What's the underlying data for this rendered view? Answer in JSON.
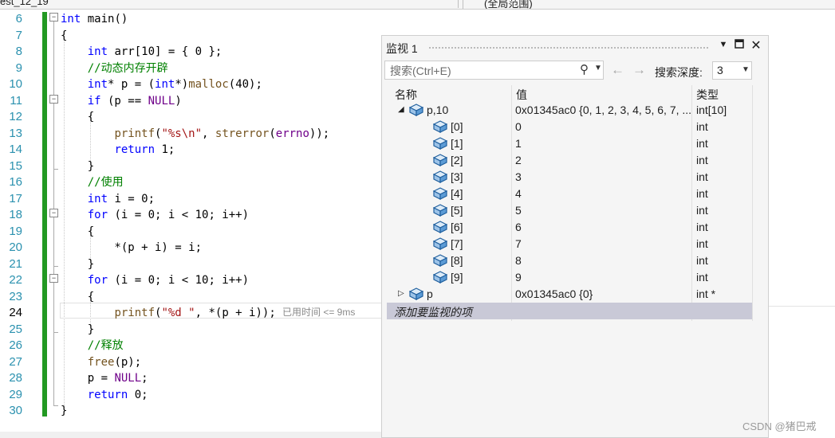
{
  "topbar": {
    "file_tab": "est_12_19",
    "scope": "(全局范围)"
  },
  "editor": {
    "current_line": 24,
    "lines": [
      {
        "n": "6",
        "segs": [
          {
            "t": "kw",
            "v": "int"
          },
          {
            "t": "",
            "v": " main()"
          }
        ]
      },
      {
        "n": "7",
        "segs": [
          {
            "t": "",
            "v": "{"
          }
        ]
      },
      {
        "n": "8",
        "segs": [
          {
            "t": "",
            "v": "    "
          },
          {
            "t": "kw",
            "v": "int"
          },
          {
            "t": "",
            "v": " arr[10] = { 0 };"
          }
        ]
      },
      {
        "n": "9",
        "segs": [
          {
            "t": "",
            "v": "    "
          },
          {
            "t": "cm",
            "v": "//动态内存开辟"
          }
        ]
      },
      {
        "n": "10",
        "segs": [
          {
            "t": "",
            "v": "    "
          },
          {
            "t": "kw",
            "v": "int"
          },
          {
            "t": "",
            "v": "* p = ("
          },
          {
            "t": "kw",
            "v": "int"
          },
          {
            "t": "",
            "v": "*)"
          },
          {
            "t": "fn",
            "v": "malloc"
          },
          {
            "t": "",
            "v": "(40);"
          }
        ]
      },
      {
        "n": "11",
        "segs": [
          {
            "t": "",
            "v": "    "
          },
          {
            "t": "kw",
            "v": "if"
          },
          {
            "t": "",
            "v": " (p == "
          },
          {
            "t": "mac",
            "v": "NULL"
          },
          {
            "t": "",
            "v": ")"
          }
        ]
      },
      {
        "n": "12",
        "segs": [
          {
            "t": "",
            "v": "    {"
          }
        ]
      },
      {
        "n": "13",
        "segs": [
          {
            "t": "",
            "v": "        "
          },
          {
            "t": "fn",
            "v": "printf"
          },
          {
            "t": "",
            "v": "("
          },
          {
            "t": "str",
            "v": "\"%s\\n\""
          },
          {
            "t": "",
            "v": ", "
          },
          {
            "t": "fn",
            "v": "strerror"
          },
          {
            "t": "",
            "v": "("
          },
          {
            "t": "mac",
            "v": "errno"
          },
          {
            "t": "",
            "v": "));"
          }
        ]
      },
      {
        "n": "14",
        "segs": [
          {
            "t": "",
            "v": "        "
          },
          {
            "t": "kw",
            "v": "return"
          },
          {
            "t": "",
            "v": " 1;"
          }
        ]
      },
      {
        "n": "15",
        "segs": [
          {
            "t": "",
            "v": "    }"
          }
        ]
      },
      {
        "n": "16",
        "segs": [
          {
            "t": "",
            "v": "    "
          },
          {
            "t": "cm",
            "v": "//使用"
          }
        ]
      },
      {
        "n": "17",
        "segs": [
          {
            "t": "",
            "v": "    "
          },
          {
            "t": "kw",
            "v": "int"
          },
          {
            "t": "",
            "v": " i = 0;"
          }
        ]
      },
      {
        "n": "18",
        "segs": [
          {
            "t": "",
            "v": "    "
          },
          {
            "t": "kw",
            "v": "for"
          },
          {
            "t": "",
            "v": " (i = 0; i < 10; i++)"
          }
        ]
      },
      {
        "n": "19",
        "segs": [
          {
            "t": "",
            "v": "    {"
          }
        ]
      },
      {
        "n": "20",
        "segs": [
          {
            "t": "",
            "v": "        *(p + i) = i;"
          }
        ]
      },
      {
        "n": "21",
        "segs": [
          {
            "t": "",
            "v": "    }"
          }
        ]
      },
      {
        "n": "22",
        "segs": [
          {
            "t": "",
            "v": "    "
          },
          {
            "t": "kw",
            "v": "for"
          },
          {
            "t": "",
            "v": " (i = 0; i < 10; i++)"
          }
        ]
      },
      {
        "n": "23",
        "segs": [
          {
            "t": "",
            "v": "    {"
          }
        ]
      },
      {
        "n": "24",
        "segs": [
          {
            "t": "",
            "v": "        "
          },
          {
            "t": "fn",
            "v": "printf"
          },
          {
            "t": "",
            "v": "("
          },
          {
            "t": "str",
            "v": "\"%d \""
          },
          {
            "t": "",
            "v": ", *(p + i));"
          }
        ]
      },
      {
        "n": "25",
        "segs": [
          {
            "t": "",
            "v": "    }"
          }
        ]
      },
      {
        "n": "26",
        "segs": [
          {
            "t": "",
            "v": "    "
          },
          {
            "t": "cm",
            "v": "//释放"
          }
        ]
      },
      {
        "n": "27",
        "segs": [
          {
            "t": "",
            "v": "    "
          },
          {
            "t": "fn",
            "v": "free"
          },
          {
            "t": "",
            "v": "(p);"
          }
        ]
      },
      {
        "n": "28",
        "segs": [
          {
            "t": "",
            "v": "    p = "
          },
          {
            "t": "mac",
            "v": "NULL"
          },
          {
            "t": "",
            "v": ";"
          }
        ]
      },
      {
        "n": "29",
        "segs": [
          {
            "t": "",
            "v": "    "
          },
          {
            "t": "kw",
            "v": "return"
          },
          {
            "t": "",
            "v": " 0;"
          }
        ]
      },
      {
        "n": "30",
        "segs": [
          {
            "t": "",
            "v": "}"
          }
        ]
      }
    ],
    "perf_tip": "已用时间 <= 9ms"
  },
  "watch": {
    "title": "监视 1",
    "search_placeholder": "搜索(Ctrl+E)",
    "depth_label": "搜索深度:",
    "depth_value": "3",
    "columns": {
      "name": "名称",
      "value": "值",
      "type": "类型"
    },
    "rows": [
      {
        "name": "p,10",
        "value": "0x01345ac0 {0, 1, 2, 3, 4, 5, 6, 7, ...",
        "type": "int[10]",
        "level": 0,
        "expander": "◢"
      },
      {
        "name": "[0]",
        "value": "0",
        "type": "int",
        "level": 1,
        "expander": ""
      },
      {
        "name": "[1]",
        "value": "1",
        "type": "int",
        "level": 1,
        "expander": ""
      },
      {
        "name": "[2]",
        "value": "2",
        "type": "int",
        "level": 1,
        "expander": ""
      },
      {
        "name": "[3]",
        "value": "3",
        "type": "int",
        "level": 1,
        "expander": ""
      },
      {
        "name": "[4]",
        "value": "4",
        "type": "int",
        "level": 1,
        "expander": ""
      },
      {
        "name": "[5]",
        "value": "5",
        "type": "int",
        "level": 1,
        "expander": ""
      },
      {
        "name": "[6]",
        "value": "6",
        "type": "int",
        "level": 1,
        "expander": ""
      },
      {
        "name": "[7]",
        "value": "7",
        "type": "int",
        "level": 1,
        "expander": ""
      },
      {
        "name": "[8]",
        "value": "8",
        "type": "int",
        "level": 1,
        "expander": ""
      },
      {
        "name": "[9]",
        "value": "9",
        "type": "int",
        "level": 1,
        "expander": ""
      },
      {
        "name": "p",
        "value": "0x01345ac0 {0}",
        "type": "int *",
        "level": 0,
        "expander": "▷"
      }
    ],
    "add_item": "添加要监视的项",
    "icons": {
      "cube": "variable-cube-icon",
      "search": "search-icon",
      "back": "back-arrow-icon",
      "forward": "forward-arrow-icon"
    }
  },
  "watermark": "CSDN @猪巴戒"
}
